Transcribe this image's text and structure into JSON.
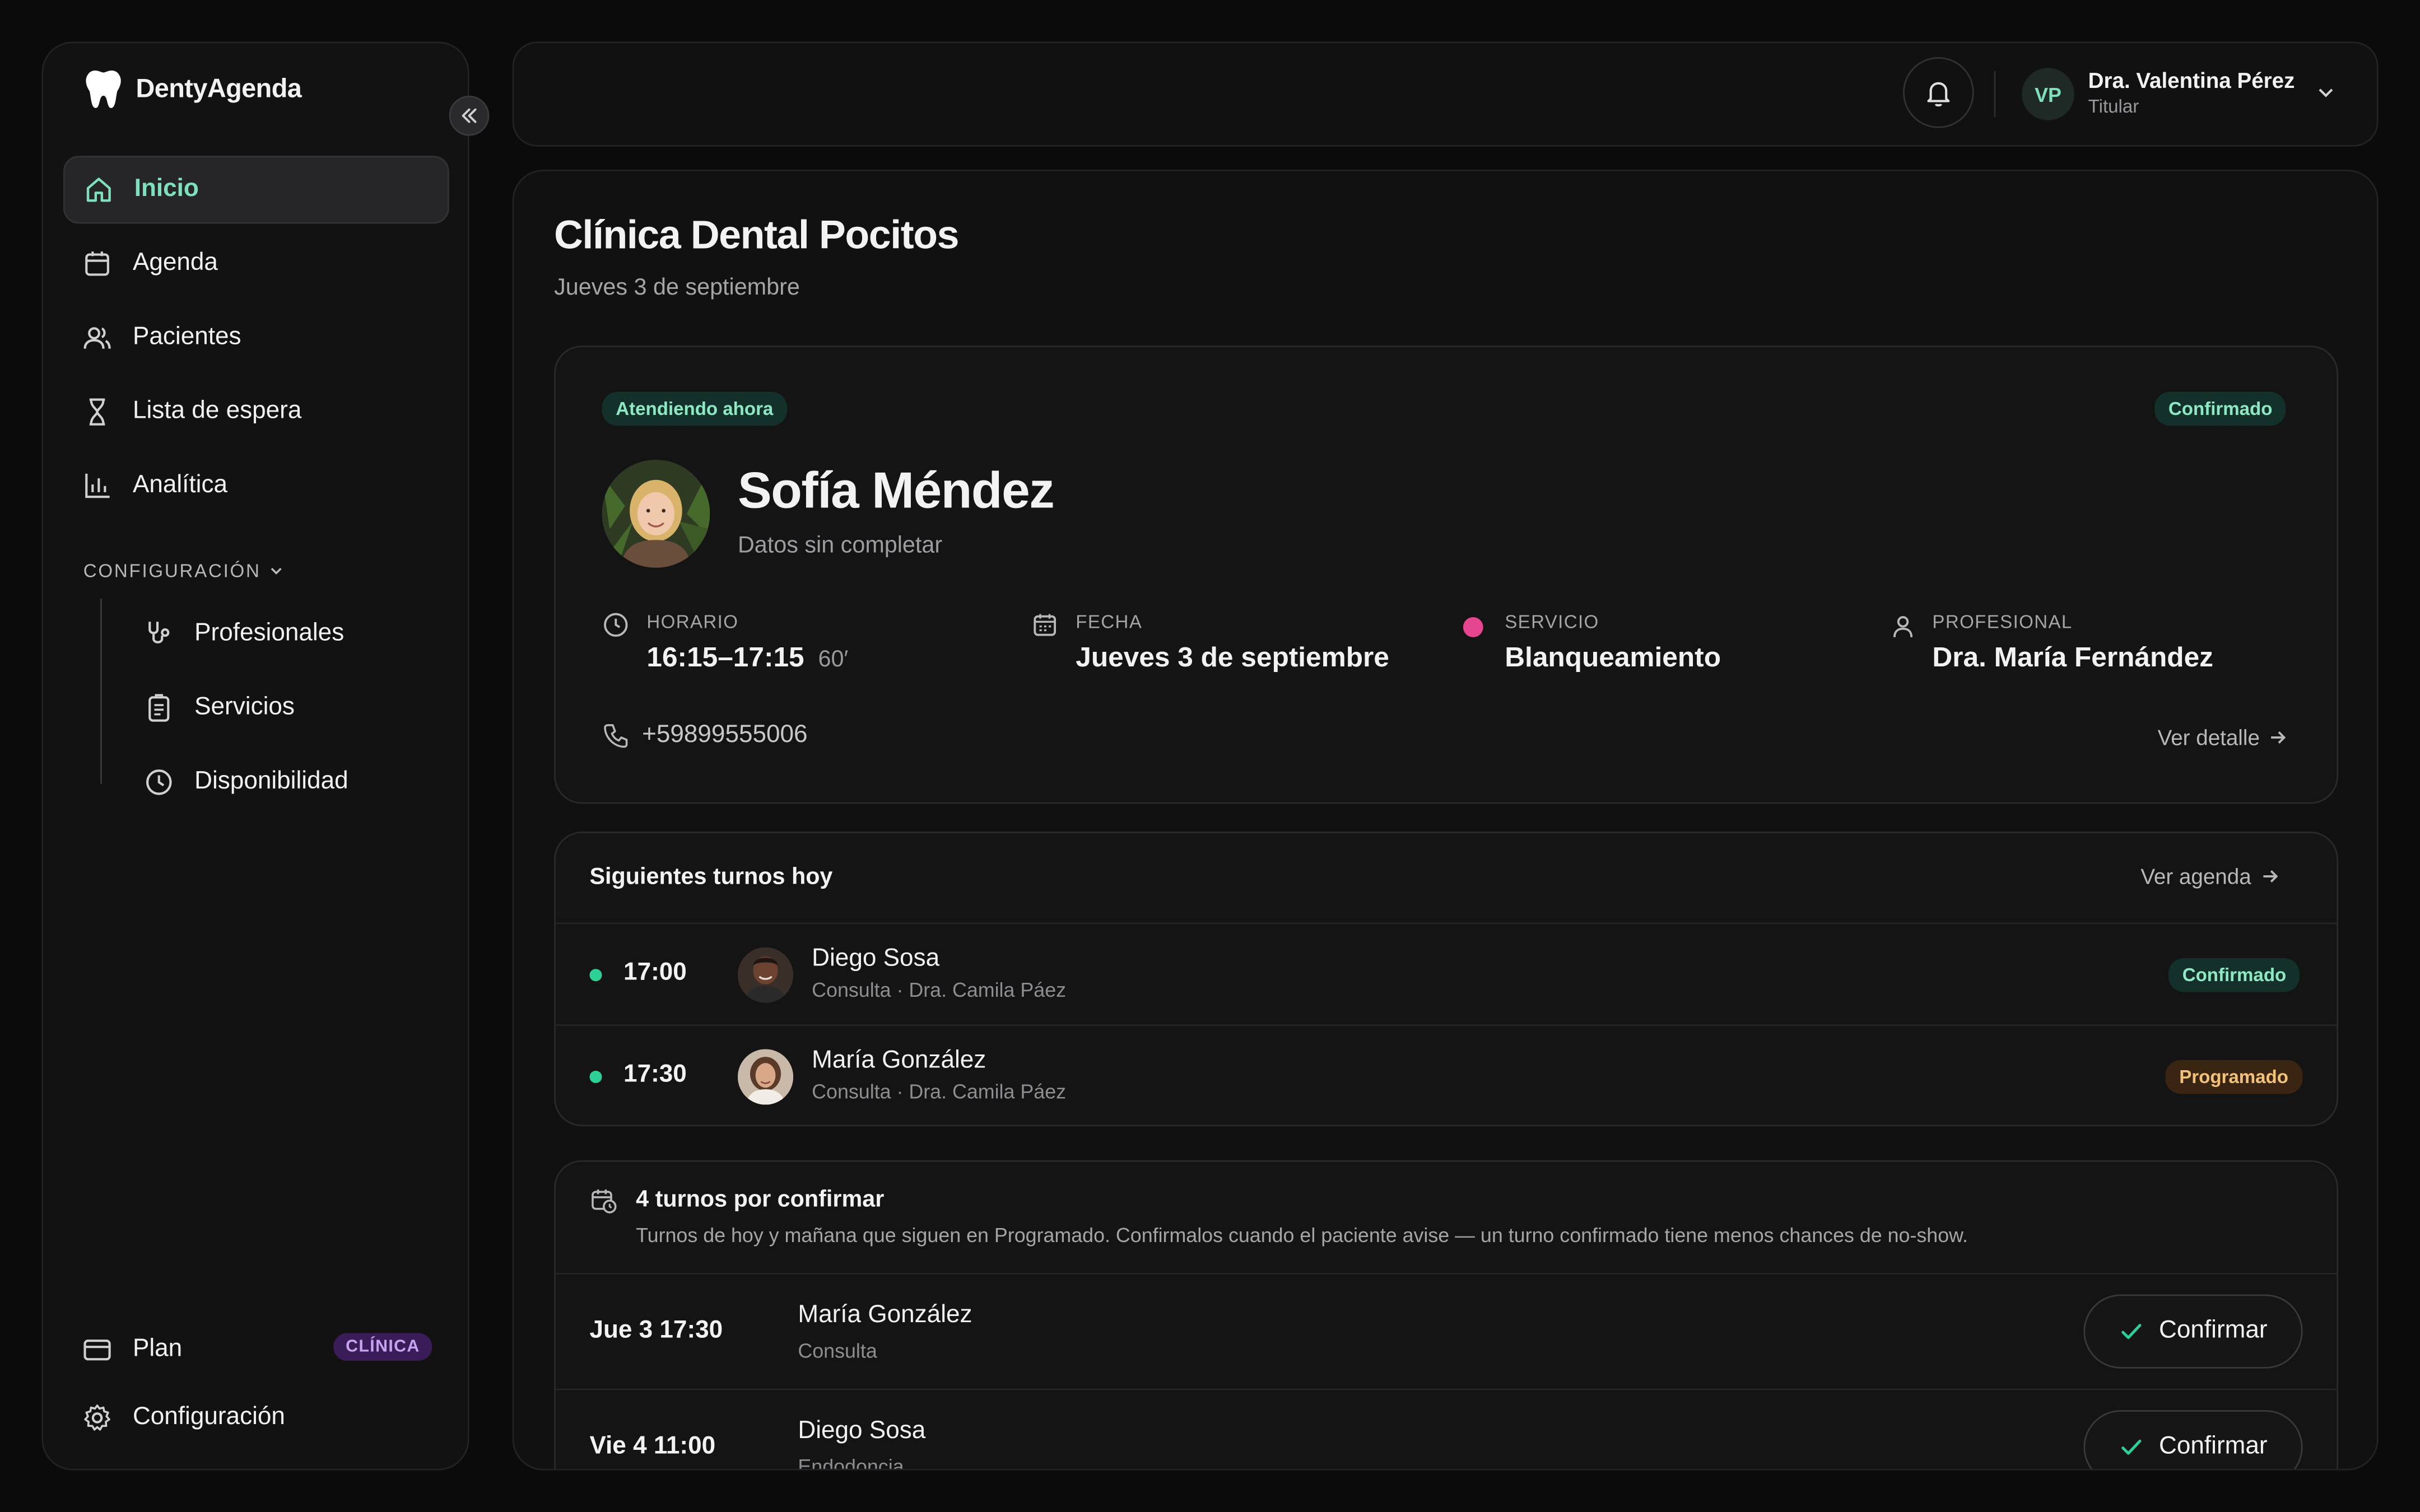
{
  "app": {
    "name": "DentyAgenda"
  },
  "sidebar": {
    "items": [
      {
        "label": "Inicio",
        "icon": "home-icon",
        "active": true
      },
      {
        "label": "Agenda",
        "icon": "calendar-icon"
      },
      {
        "label": "Pacientes",
        "icon": "users-icon"
      },
      {
        "label": "Lista de espera",
        "icon": "hourglass-icon"
      },
      {
        "label": "Analítica",
        "icon": "bar-chart-icon"
      }
    ],
    "config_section": "CONFIGURACIÓN",
    "config_items": [
      {
        "label": "Profesionales",
        "icon": "stethoscope-icon"
      },
      {
        "label": "Servicios",
        "icon": "clipboard-icon"
      },
      {
        "label": "Disponibilidad",
        "icon": "clock-icon"
      }
    ],
    "plan": {
      "label": "Plan",
      "badge": "CLÍNICA"
    },
    "settings_label": "Configuración"
  },
  "topbar": {
    "user": {
      "initials": "VP",
      "name": "Dra. Valentina Pérez",
      "role": "Titular"
    }
  },
  "page": {
    "title": "Clínica Dental Pocitos",
    "date": "Jueves 3 de septiembre"
  },
  "current": {
    "status_label": "Atendiendo ahora",
    "status_badge": "Confirmado",
    "patient_name": "Sofía Méndez",
    "patient_note": "Datos sin completar",
    "horario_label": "HORARIO",
    "horario_value": "16:15–17:15",
    "duration": "60′",
    "fecha_label": "FECHA",
    "fecha_value": "Jueves 3 de septiembre",
    "servicio_label": "SERVICIO",
    "servicio_value": "Blanqueamiento",
    "servicio_color": "#e5468f",
    "profesional_label": "PROFESIONAL",
    "profesional_value": "Dra. María Fernández",
    "phone": "+59899555006",
    "detail_link": "Ver detalle"
  },
  "next": {
    "title": "Siguientes turnos hoy",
    "link": "Ver agenda",
    "rows": [
      {
        "time": "17:00",
        "name": "Diego Sosa",
        "sub": "Consulta · Dra. Camila Páez",
        "badge": "Confirmado"
      },
      {
        "time": "17:30",
        "name": "María González",
        "sub": "Consulta · Dra. Camila Páez",
        "badge": "Programado"
      }
    ]
  },
  "pending": {
    "title": "4 turnos por confirmar",
    "desc": "Turnos de hoy y mañana que siguen en Programado. Confirmalos cuando el paciente avise — un turno confirmado tiene menos chances de no-show.",
    "rows": [
      {
        "when": "Jue 3 17:30",
        "name": "María González",
        "service": "Consulta",
        "action": "Confirmar"
      },
      {
        "when": "Vie 4 11:00",
        "name": "Diego Sosa",
        "service": "Endodoncia",
        "action": "Confirmar"
      }
    ]
  },
  "colors": {
    "accent": "#7fe0bd",
    "background": "#0b0b0c",
    "panel": "#111112"
  }
}
